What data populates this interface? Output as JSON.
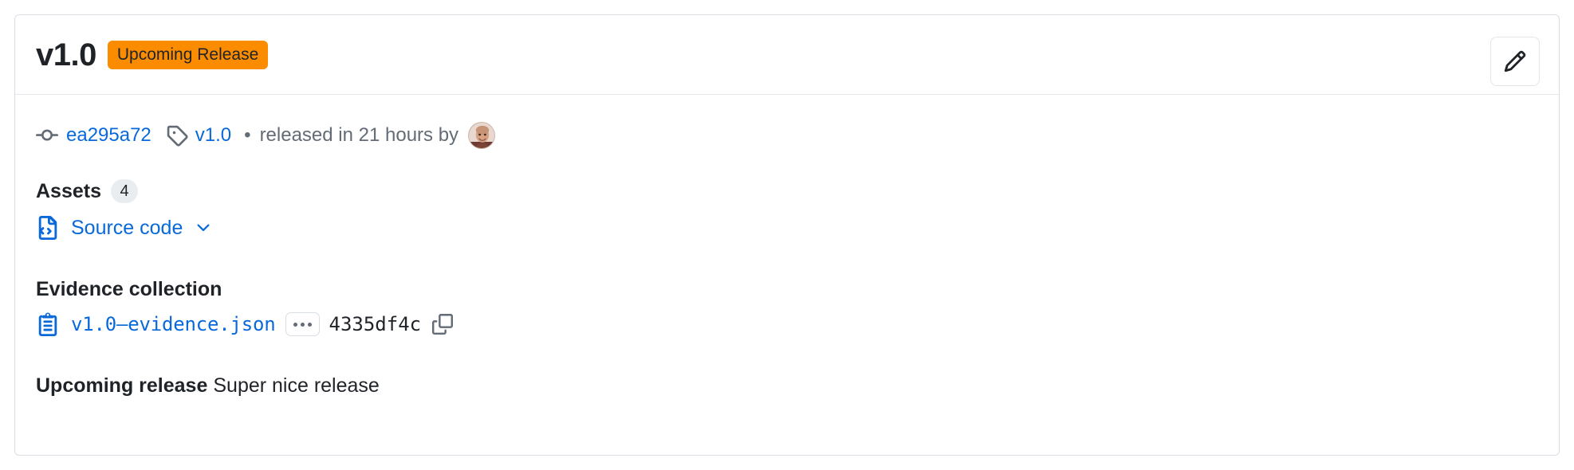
{
  "card": {
    "header": {
      "title": "v1.0",
      "badge_label": "Upcoming Release",
      "badge_color": "#fb8c00",
      "edit_button_name": "pencil-icon"
    },
    "meta": {
      "commit_hash": "ea295a72",
      "tag_name": "v1.0",
      "separator": "•",
      "released_text": "released in 21 hours by",
      "author_avatar": "avatar-photo"
    },
    "assets": {
      "heading": "Assets",
      "count": "4",
      "items": [
        {
          "label": "Source code",
          "icon": "file-code-icon",
          "chevron": "chevron-down-icon"
        }
      ]
    },
    "evidence": {
      "heading": "Evidence collection",
      "file_name": "v1.0–evidence.json",
      "overflow_label": "...",
      "hash": "4335df4c",
      "copy_icon": "copy-icon"
    },
    "description": {
      "label": "Upcoming release",
      "text": "Super nice release"
    }
  },
  "colors": {
    "link": "#0969da",
    "accent_orange": "#fb8c00",
    "text_primary": "#1f2328",
    "text_muted": "#636c76",
    "border": "#d8dee4"
  }
}
